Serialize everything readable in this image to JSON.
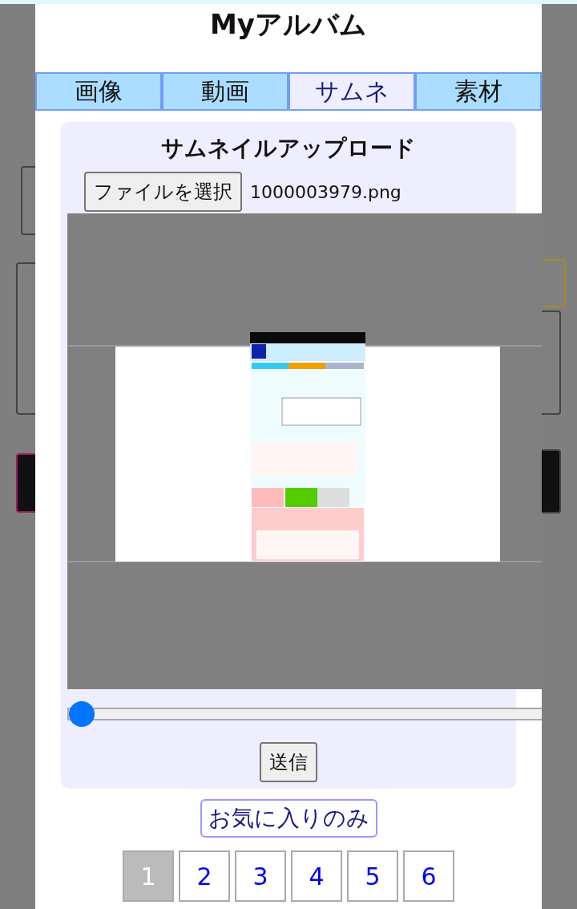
{
  "modal": {
    "title": "Myアルバム",
    "tabs": [
      {
        "label": "画像",
        "selected": false
      },
      {
        "label": "動画",
        "selected": false
      },
      {
        "label": "サムネ",
        "selected": true
      },
      {
        "label": "素材",
        "selected": false
      }
    ],
    "upload": {
      "title": "サムネイルアップロード",
      "file_button": "ファイルを選択",
      "file_name": "1000003979.png",
      "zoom_slider": {
        "level": 0
      },
      "submit_button": "送信"
    },
    "favorites_button": "お気に入りのみ",
    "pages": [
      {
        "label": "1",
        "selected": true
      },
      {
        "label": "2",
        "selected": false
      },
      {
        "label": "3",
        "selected": false
      },
      {
        "label": "4",
        "selected": false
      },
      {
        "label": "5",
        "selected": false
      },
      {
        "label": "6",
        "selected": false
      }
    ]
  }
}
